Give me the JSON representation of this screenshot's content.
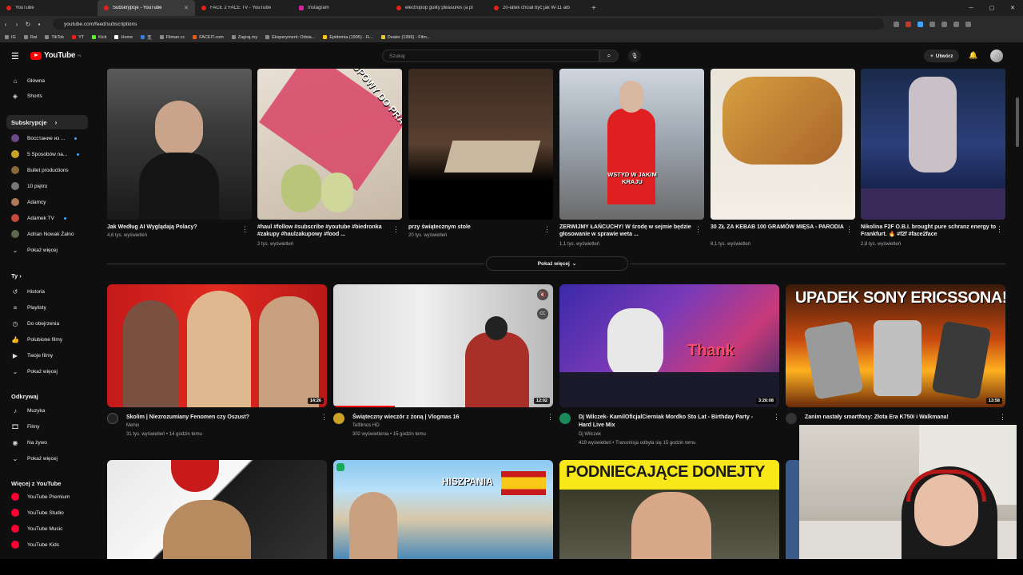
{
  "browser": {
    "tabs": [
      {
        "label": "YouTube",
        "active": false,
        "icon": "youtube-icon"
      },
      {
        "label": "Subskrypcje - YouTube",
        "active": true,
        "icon": "youtube-icon"
      },
      {
        "label": "FACE 2 FACE TV - YouTube",
        "active": false,
        "icon": "youtube-icon"
      },
      {
        "label": "Instagram",
        "active": false,
        "icon": "instagram-icon"
      },
      {
        "label": "electropop guilty pleasures (a pl",
        "active": false,
        "icon": "youtube-icon"
      },
      {
        "label": "20-latek chciał być jak W-11 alb",
        "active": false,
        "icon": "youtube-icon"
      }
    ],
    "new_tab": "+",
    "url": "youtube.com/feed/subscriptions",
    "bookmarks": [
      "IG",
      "Rat",
      "TikTok",
      "YT",
      "Kick",
      "Home",
      "芜",
      "Filman.cc",
      "FACEIT.com",
      "Zagraj.my",
      "Eksperyment: Odsia...",
      "Epidemia (1995) - Fi...",
      "Dealer (1996) - Film..."
    ]
  },
  "header": {
    "logo": "YouTube",
    "region": "PL",
    "search_placeholder": "Szukaj",
    "create_label": "Utwórz"
  },
  "sidebar": {
    "main": [
      {
        "label": "Główna",
        "icon": "home-icon"
      },
      {
        "label": "Shorts",
        "icon": "shorts-icon"
      }
    ],
    "subs_title": "Subskrypcje",
    "subs": [
      {
        "label": "Восстание из ...",
        "dot": true,
        "color": "#6b4a8a"
      },
      {
        "label": "5 Sposobów na...",
        "dot": true,
        "color": "#c9a227"
      },
      {
        "label": "Bullet productions",
        "dot": false,
        "color": "#8a6a3a"
      },
      {
        "label": "10 piętro",
        "dot": false,
        "color": "#777777"
      },
      {
        "label": "Adamcy",
        "dot": false,
        "color": "#b07a5a"
      },
      {
        "label": "Adamek TV",
        "dot": true,
        "color": "#c44a3a"
      },
      {
        "label": "Adrian Nowak Żalno",
        "dot": false,
        "color": "#5a6a4a"
      }
    ],
    "show_more": "Pokaż więcej",
    "you_title": "Ty",
    "you": [
      {
        "label": "Historia",
        "icon": "history-icon"
      },
      {
        "label": "Playlisty",
        "icon": "playlist-icon"
      },
      {
        "label": "Do obejrzenia",
        "icon": "watch-later-icon"
      },
      {
        "label": "Polubione filmy",
        "icon": "like-icon"
      },
      {
        "label": "Twoje filmy",
        "icon": "your-videos-icon"
      }
    ],
    "explore_title": "Odkrywaj",
    "explore": [
      {
        "label": "Muzyka",
        "icon": "music-icon"
      },
      {
        "label": "Filmy",
        "icon": "movies-icon"
      },
      {
        "label": "Na żywo",
        "icon": "live-icon"
      }
    ],
    "more_title": "Więcej z YouTube",
    "more": [
      {
        "label": "YouTube Premium"
      },
      {
        "label": "YouTube Studio"
      },
      {
        "label": "YouTube Music"
      },
      {
        "label": "YouTube Kids"
      }
    ]
  },
  "shorts": [
    {
      "title": "Jak Według AI Wyglądają Polacy?",
      "views": "4,6 tys. wyświetleń"
    },
    {
      "title": "#haul #follow #subscribe #youtube #biedronka #zakupy #haulzakupowy #food ...",
      "views": "2 tys. wyświetleń",
      "overlay": "HAUL ZAKUPOWY DO PRACY JEDZENIE Z BIEDRONKI"
    },
    {
      "title": "przy świątecznym stole",
      "views": "20 tys. wyświetleń"
    },
    {
      "title": "ZERWIJMY ŁAŃCUCHY! W środę w sejmie będzie głosowanie w sprawie weta ...",
      "views": "1,1 tys. wyświetleń",
      "overlay": "WSTYD W JAKIM KRAJU"
    },
    {
      "title": "30 ZŁ ZA KEBAB 100 GRAMÓW MIĘSA - PARODIA",
      "views": "8,1 tys. wyświetleń"
    },
    {
      "title": "Nikolina F2F O.B.I. brought pure schranz energy to Frankfurt. 🔥 #f2f #face2face",
      "views": "2,8 tys. wyświetleń"
    }
  ],
  "shorts_show_more": "Pokaż więcej",
  "videos": [
    {
      "title": "Skolim | Niezrozumiany Fenomen czy Oszust?",
      "channel": "Mehio",
      "meta": "31 tys. wyświetleń • 14 godzin temu",
      "duration": "14:26",
      "progress": 0
    },
    {
      "title": "Świąteczny wieczór z żoną | Vlogmas 16",
      "channel": "Telfilmos HD",
      "meta": "302 wyświetlenia • 15 godzin temu",
      "duration": "12:02",
      "progress": 0.28
    },
    {
      "title": "Dj Wilczek- KamilOficjalCierniak Mordko Sto Lat - Birthday Party - Hard Live Mix",
      "channel": "Dj Wilczek",
      "meta": "419 wyświetleń • Transmisja odbyła się 15 godzin temu",
      "duration": "3:26:08",
      "progress": 0,
      "overlay": "Thank"
    },
    {
      "title": "Zanim nastały smartfony: Złota Era K750i i Walkmana!",
      "channel": "",
      "meta": "",
      "duration": "13:58",
      "progress": 0,
      "overlay": "UPADEK SONY ERICSSONA!"
    }
  ],
  "row3": [
    {
      "overlay": ""
    },
    {
      "overlay": "HISZPANIA"
    },
    {
      "overlay": "PODNIECAJĄCE DONEJTY"
    }
  ],
  "colors": {
    "accent": "#ff0000",
    "bg": "#0f0f0f",
    "link": "#3ea6ff"
  }
}
